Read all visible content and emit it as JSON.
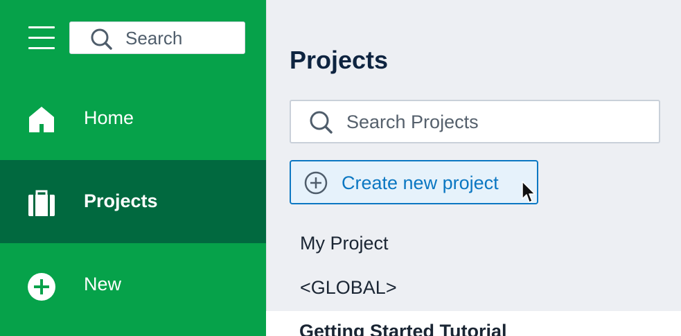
{
  "sidebar": {
    "search": {
      "placeholder": "Search"
    },
    "nav": [
      {
        "label": "Home",
        "icon": "home-icon"
      },
      {
        "label": "Projects",
        "icon": "briefcase-icon",
        "active": true
      },
      {
        "label": "New",
        "icon": "plus-circle-icon"
      }
    ]
  },
  "main": {
    "title": "Projects",
    "search": {
      "placeholder": "Search Projects"
    },
    "create_button": {
      "label": "Create new project",
      "icon": "plus-circle-icon"
    },
    "projects": [
      {
        "label": "My Project"
      },
      {
        "label": "<GLOBAL>"
      },
      {
        "label": "Getting Started Tutorial"
      }
    ]
  },
  "colors": {
    "sidebar_bg": "#06a24a",
    "sidebar_active_bg": "#01693f",
    "main_bg": "#edeff3",
    "accent": "#0b77c2",
    "title": "#0e2440"
  }
}
